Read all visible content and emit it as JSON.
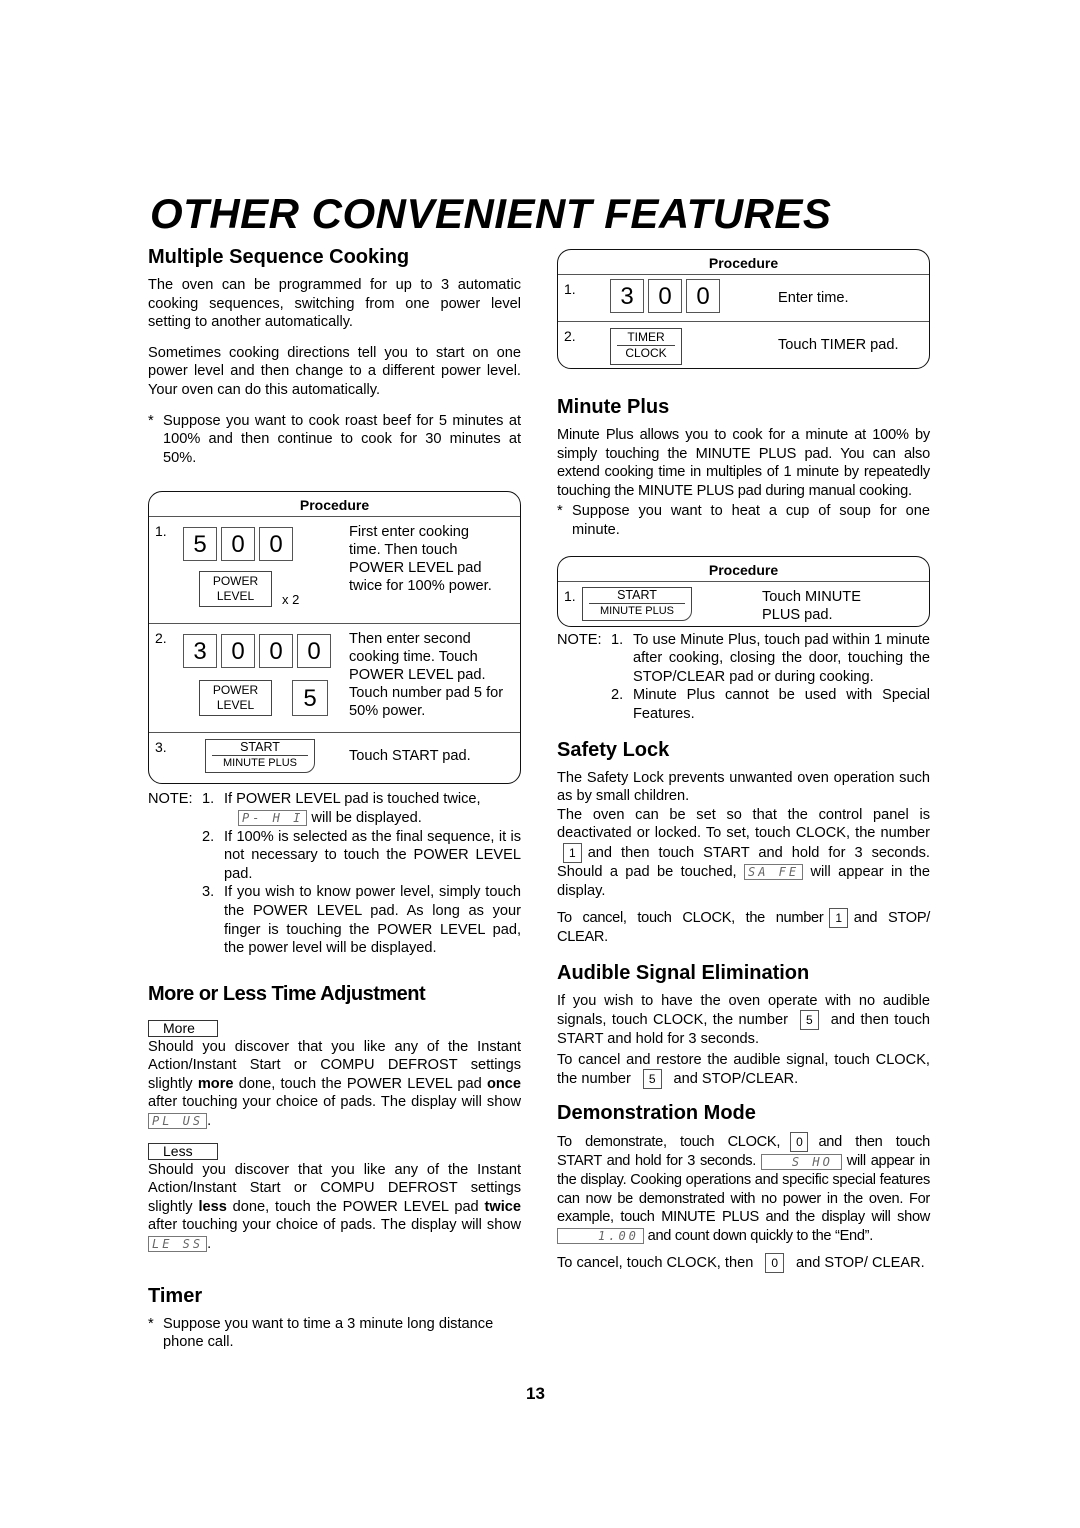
{
  "page": {
    "title": "OTHER CONVENIENT FEATURES",
    "page_number": "13"
  },
  "multiple_sequence": {
    "heading": "Multiple Sequence Cooking",
    "para1": "The oven can be programmed for up to 3 automatic cooking sequences, switching from one power level setting to another automatically.",
    "para2": "Sometimes cooking directions tell you to start on one power level and then change to a different power level. Your oven can do this automatically.",
    "example": "Suppose you want to cook roast beef for 5 minutes at 100% and then continue to cook for 30 minutes at 50%.",
    "bullet": "*",
    "procedure": {
      "header": "Procedure",
      "steps": [
        {
          "num": "1.",
          "digits": [
            "5",
            "0",
            "0"
          ],
          "pad_top": "POWER",
          "pad_bottom": "LEVEL",
          "multiplier": "x 2",
          "text": "First enter cooking time. Then touch POWER LEVEL pad twice for 100% power."
        },
        {
          "num": "2.",
          "digits": [
            "3",
            "0",
            "0",
            "0"
          ],
          "pad_top": "POWER",
          "pad_bottom": "LEVEL",
          "number_pad": "5",
          "text": "Then enter second cooking time. Touch POWER LEVEL pad. Touch number pad 5 for 50% power."
        },
        {
          "num": "3.",
          "pad_top": "START",
          "pad_bottom": "MINUTE PLUS",
          "text": "Touch START pad."
        }
      ]
    },
    "notes": {
      "label": "NOTE:",
      "items": [
        {
          "num": "1.",
          "text_before": "If POWER LEVEL pad is touched twice,",
          "display": "P-  H I",
          "text_after": "will be displayed."
        },
        {
          "num": "2.",
          "text": "If 100% is selected as the final sequence, it is not necessary to touch the POWER LEVEL pad."
        },
        {
          "num": "3.",
          "text": "If you wish to know power level, simply touch the POWER LEVEL pad. As long as your finger is touching the POWER LEVEL pad, the power level will be displayed."
        }
      ]
    }
  },
  "more_less": {
    "heading": "More or Less Time Adjustment",
    "more_label": "More",
    "more_text_1": "Should you discover that you like any of the Instant Action/Instant Start  or COMPU DEFROST settings slightly ",
    "more_bold_1": "more",
    "more_text_2": " done, touch the POWER LEVEL pad ",
    "more_bold_2": "once",
    "more_text_3": " after touching your choice of pads. The display will show ",
    "more_display": "PL  US",
    "less_label": "Less",
    "less_text_1": "Should you discover that you like any of the Instant Action/Instant Start or COMPU DEFROST settings slightly ",
    "less_bold_1": "less",
    "less_text_2": " done, touch the POWER LEVEL pad ",
    "less_bold_2": "twice",
    "less_text_3": " after touching your choice of pads. The display will show ",
    "less_display": "LE  SS",
    "period": "."
  },
  "timer": {
    "heading": "Timer",
    "bullet": "*",
    "example": "Suppose you want to time a 3 minute long distance phone call.",
    "procedure": {
      "header": "Procedure",
      "steps": [
        {
          "num": "1.",
          "digits": [
            "3",
            "0",
            "0"
          ],
          "text": "Enter time."
        },
        {
          "num": "2.",
          "pad_top": "TIMER",
          "pad_bottom": "CLOCK",
          "text": "Touch TIMER pad."
        }
      ]
    }
  },
  "minute_plus": {
    "heading": "Minute Plus",
    "para": "Minute Plus allows you to cook for a minute at 100% by simply touching the MINUTE PLUS pad. You can also extend cooking time in multiples of 1 minute by repeatedly touching the MINUTE PLUS pad during manual cooking.",
    "bullet": "*",
    "example": "Suppose you want to heat a cup of soup for one minute.",
    "procedure": {
      "header": "Procedure",
      "steps": [
        {
          "num": "1.",
          "pad_top": "START",
          "pad_bottom": "MINUTE PLUS",
          "text": "Touch MINUTE PLUS pad."
        }
      ]
    },
    "notes": {
      "label": "NOTE:",
      "items": [
        {
          "num": "1.",
          "text": "To use Minute Plus, touch pad within 1 minute after cooking, closing the door, touching the STOP/CLEAR pad or during cooking."
        },
        {
          "num": "2.",
          "text": "Minute Plus cannot be used with Special Features."
        }
      ]
    }
  },
  "safety_lock": {
    "heading": "Safety Lock",
    "para1": "The Safety Lock prevents unwanted oven operation such as by small children.",
    "para2_a": "The oven can be set so that the control panel is deactivated or locked. To set, touch CLOCK, the number",
    "key1": "1",
    "para2_b": "and then touch START and hold for 3 seconds. Should a pad be touched,",
    "display": "SA  FE",
    "para2_c": "will appear in the display.",
    "cancel_a": "To cancel, touch CLOCK, the number",
    "cancel_key": "1",
    "cancel_b": "and STOP/ CLEAR."
  },
  "audible": {
    "heading": "Audible Signal Elimination",
    "para1_a": "If you wish to have the oven operate with no audible signals, touch CLOCK, the number",
    "key1": "5",
    "para1_b": "and then touch START and hold for 3 seconds.",
    "para2_a": "To cancel and restore the audible signal, touch CLOCK, the number",
    "key2": "5",
    "para2_b": "and STOP/CLEAR."
  },
  "demo": {
    "heading": "Demonstration Mode",
    "para1_a": "To demonstrate, touch CLOCK,",
    "key1": "0",
    "para1_b": "and then touch START and hold for 3 seconds.",
    "display1": "S  HO",
    "para1_c": "will appear in the display. Cooking operations and specific special features can now be demonstrated with no power in the oven. For example, touch MINUTE PLUS and the display will show",
    "display2": "1.00",
    "para1_d": "and count down quickly to the “End”.",
    "cancel_a": "To cancel, touch CLOCK, then",
    "cancel_key": "0",
    "cancel_b": "and STOP/ CLEAR."
  }
}
